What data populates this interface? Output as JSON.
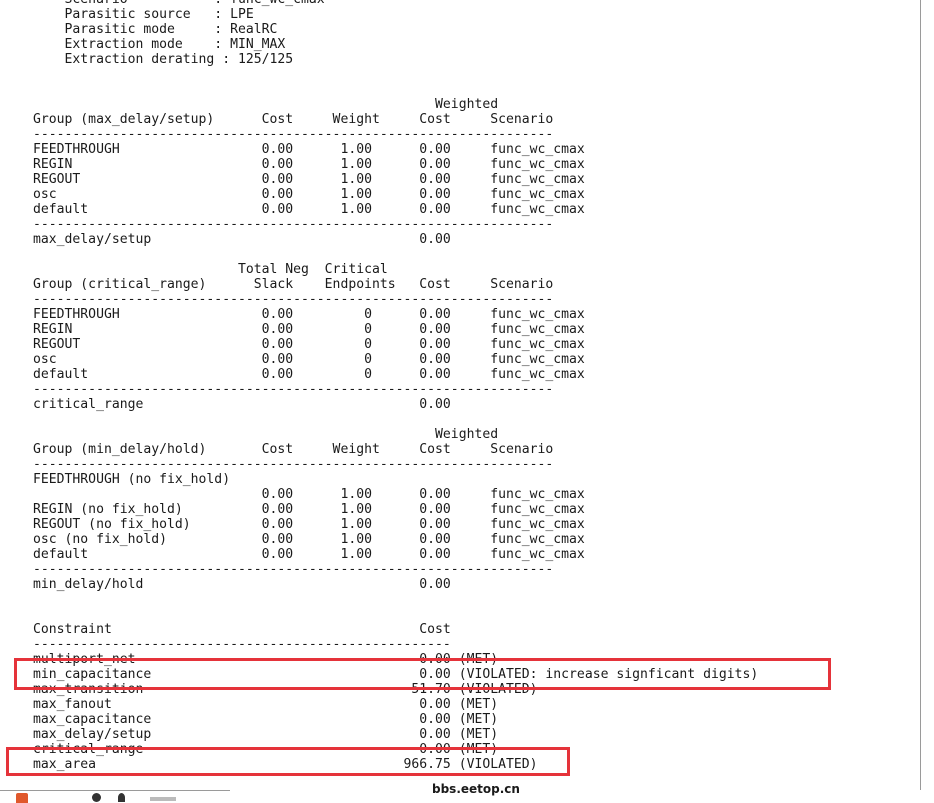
{
  "report_lines": [
    "    Scenario           : func_wc_cmax",
    "    Parasitic source   : LPE",
    "    Parasitic mode     : RealRC",
    "    Extraction mode    : MIN_MAX",
    "    Extraction derating : 125/125",
    "",
    "",
    "                                                   Weighted",
    "Group (max_delay/setup)      Cost     Weight     Cost     Scenario",
    "------------------------------------------------------------------",
    "FEEDTHROUGH                  0.00      1.00      0.00     func_wc_cmax",
    "REGIN                        0.00      1.00      0.00     func_wc_cmax",
    "REGOUT                       0.00      1.00      0.00     func_wc_cmax",
    "osc                          0.00      1.00      0.00     func_wc_cmax",
    "default                      0.00      1.00      0.00     func_wc_cmax",
    "------------------------------------------------------------------",
    "max_delay/setup                                  0.00",
    "",
    "                          Total Neg  Critical",
    "Group (critical_range)      Slack    Endpoints   Cost     Scenario",
    "------------------------------------------------------------------",
    "FEEDTHROUGH                  0.00         0      0.00     func_wc_cmax",
    "REGIN                        0.00         0      0.00     func_wc_cmax",
    "REGOUT                       0.00         0      0.00     func_wc_cmax",
    "osc                          0.00         0      0.00     func_wc_cmax",
    "default                      0.00         0      0.00     func_wc_cmax",
    "------------------------------------------------------------------",
    "critical_range                                   0.00",
    "",
    "                                                   Weighted",
    "Group (min_delay/hold)       Cost     Weight     Cost     Scenario",
    "------------------------------------------------------------------",
    "FEEDTHROUGH (no fix_hold)",
    "                             0.00      1.00      0.00     func_wc_cmax",
    "REGIN (no fix_hold)          0.00      1.00      0.00     func_wc_cmax",
    "REGOUT (no fix_hold)         0.00      1.00      0.00     func_wc_cmax",
    "osc (no fix_hold)            0.00      1.00      0.00     func_wc_cmax",
    "default                      0.00      1.00      0.00     func_wc_cmax",
    "------------------------------------------------------------------",
    "min_delay/hold                                   0.00",
    "",
    "",
    "Constraint                                       Cost",
    "-----------------------------------------------------",
    "multiport_net                                    0.00 (MET)",
    "min_capacitance                                  0.00 (VIOLATED: increase signficant digits)",
    "max_transition                                  51.70 (VIOLATED)",
    "max_fanout                                       0.00 (MET)",
    "max_capacitance                                  0.00 (MET)",
    "max_delay/setup                                  0.00 (MET)",
    "critical_range                                   0.00 (MET)",
    "max_area                                       966.75 (VIOLATED)"
  ],
  "watermark": "bbs.eetop.cn",
  "colors": {
    "highlight": "#e5333a",
    "text": "#1a1a1a",
    "background": "#ffffff"
  }
}
